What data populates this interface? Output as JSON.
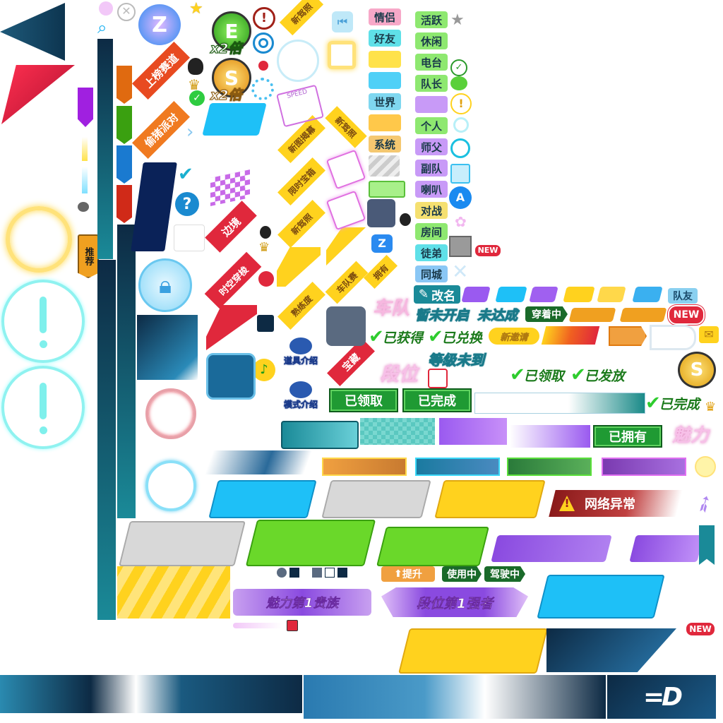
{
  "ribbons": {
    "top_rank": "上榜赛道",
    "steal_party": "偷猪派对",
    "border": "边境",
    "time_travel": "时空穿梭",
    "new_photo1": "新驾照",
    "new_unveil": "新图揭幕",
    "limited_treasure": "限时宝箱",
    "new_photo2": "新驾照",
    "proficiency": "熟练度",
    "new_photo3": "新驾照",
    "carteam": "车队赛",
    "own": "拥有",
    "treasure": "宝藏"
  },
  "side_badge": "推荐",
  "multiplier": {
    "e": "x2倍",
    "s": "x2倍",
    "e_letter": "E",
    "s_letter": "S"
  },
  "intro": {
    "props": "道具介绍",
    "mode": "模式介绍"
  },
  "channels_left": [
    "情侣",
    "好友",
    "",
    "",
    "世界",
    "",
    "系统"
  ],
  "channels_right": [
    "活跃",
    "休闲",
    "电台",
    "队长",
    "",
    "个人",
    "师父",
    "副队",
    "喇叭",
    "对战",
    "房间",
    "徒弟",
    "同城"
  ],
  "chip_colors_left": [
    "#f7a8c8",
    "#5fe0e8",
    "#ffe24a",
    "#4fd0f7",
    "#7fd7f0",
    "#ffc84a",
    "#f5c870"
  ],
  "chip_colors_right": [
    "#8ee870",
    "#8ee870",
    "#8ee870",
    "#8ee870",
    "#c89af7",
    "#8ee870",
    "#c89af7",
    "#c89af7",
    "#c89af7",
    "#f5e070",
    "#8ee870",
    "#5fe0e8",
    "#8ac7f5"
  ],
  "labels": {
    "rename": "改名",
    "team_friend": "队友",
    "new": "NEW",
    "carteam_big": "车队",
    "not_open": "暂未开启",
    "not_reached": "未达成",
    "wearing": "穿着中",
    "obtained": "已获得",
    "exchanged": "已兑换",
    "new_invite": "新邀请",
    "level_not": "等级未到",
    "rank": "段位",
    "claimed": "已领取",
    "issued": "已发放",
    "claimed_btn": "已领取",
    "completed_btn": "已完成",
    "completed": "已完成",
    "owned_btn": "已拥有",
    "charm": "魅力",
    "network_error": "网络异常",
    "upgrade": "提升",
    "in_use": "使用中",
    "driving": "驾驶中",
    "charm_noble": "魅力第1贵族",
    "rank_strongest": "段位第1强者",
    "speed": "SPEED",
    "new2": "NEW"
  },
  "icons": [
    "search-icon",
    "close-icon",
    "star-icon",
    "exclamation-icon",
    "question-icon",
    "checkmark-icon",
    "lock-icon",
    "gift-icon",
    "app-store-icon",
    "clock-icon",
    "wechat-icon",
    "qq-penguin-icon",
    "crown-icon",
    "dice-icon",
    "mail-icon",
    "music-icon",
    "download-icon",
    "flag-icon",
    "chevron-right-icon",
    "feather-icon"
  ],
  "colors": {
    "teal_dark": "#0d2a44",
    "teal": "#1a8a98",
    "orange": "#f0a020",
    "green_btn": "#1f9a33",
    "blue": "#1ec0f7",
    "yellow": "#ffd21e",
    "purple": "#9a5af0",
    "red": "#e0283c"
  }
}
